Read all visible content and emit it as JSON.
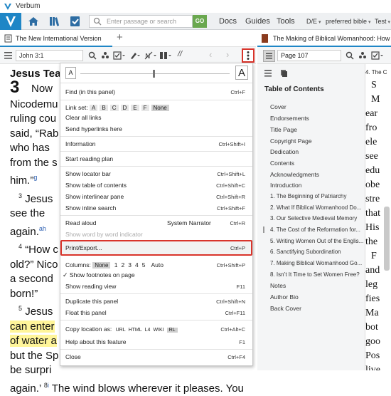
{
  "app": {
    "title": "Verbum"
  },
  "toolbar": {
    "search_placeholder": "Enter passage or search",
    "go_label": "GO",
    "docs_label": "Docs",
    "guides_label": "Guides",
    "tools_label": "Tools",
    "lang_label": "D/E",
    "bible_pref_label": "preferred bible",
    "test_label": "Test"
  },
  "left_panel": {
    "tab_title": "The New International Version",
    "reference": "John 3:1",
    "text": {
      "heading": "Jesus Tea",
      "chapter": "3",
      "lines": [
        "Now",
        "Nicodemu",
        "ruling cou",
        "said, “Rab",
        "who has",
        "from the s",
        "him.”",
        "Jesus",
        "see the",
        "again.",
        "“How c",
        "old?” Nico",
        "a second",
        "born!”",
        "Jesus",
        "can enter",
        "of water a",
        "but the Sp",
        "be surpri",
        "again.’"
      ],
      "verse_3": "3",
      "verse_4": "4",
      "verse_5": "5",
      "verse_8": "8",
      "fn_g": "g",
      "fn_ah": "a",
      "fn_h": "h",
      "fn_i": "i",
      "trailing_text": "The wind blows wherever it pleases. You"
    }
  },
  "dropdown": {
    "zoom_small": "A",
    "zoom_large": "A",
    "find_label": "Find (in this panel)",
    "find_key": "Ctrl+F",
    "link_set_label": "Link set:",
    "link_set_options": [
      "A",
      "B",
      "C",
      "D",
      "E",
      "F",
      "None"
    ],
    "clear_links": "Clear all links",
    "send_hyperlinks": "Send hyperlinks here",
    "information": "Information",
    "information_key": "Ctrl+Shift+I",
    "start_reading_plan": "Start reading plan",
    "show_locator_bar": "Show locator bar",
    "show_locator_bar_key": "Ctrl+Shift+L",
    "show_toc": "Show table of contents",
    "show_toc_key": "Ctrl+Shift+C",
    "show_interlinear": "Show interlinear pane",
    "show_interlinear_key": "Ctrl+Shift+R",
    "show_inline_search": "Show inline search",
    "show_inline_search_key": "Ctrl+Shift+F",
    "read_aloud": "Read aloud",
    "read_aloud_voice": "System Narrator",
    "read_aloud_key": "Ctrl+R",
    "show_word_indicator": "Show word by word indicator",
    "print_export": "Print/Export...",
    "print_export_key": "Ctrl+P",
    "columns_label": "Columns:",
    "columns_options": [
      "None",
      "1",
      "2",
      "3",
      "4",
      "5",
      "Auto"
    ],
    "columns_key": "Ctrl+Shift+P",
    "show_footnotes": "Show footnotes on page",
    "show_reading_view": "Show reading view",
    "show_reading_view_key": "F11",
    "duplicate_panel": "Duplicate this panel",
    "duplicate_panel_key": "Ctrl+Shift+N",
    "float_panel": "Float this panel",
    "float_panel_key": "Ctrl+F11",
    "copy_location_label": "Copy location as:",
    "copy_location_options": [
      "URL",
      "HTML",
      "L4",
      "WIKI",
      "RL"
    ],
    "copy_location_key": "Ctrl+Alt+C",
    "help_feature": "Help about this feature",
    "help_feature_key": "F1",
    "close": "Close",
    "close_key": "Ctrl+F4"
  },
  "right_panel": {
    "tab_title": "The Making of Biblical Womanhood: How the",
    "page": "Page 107",
    "subtab": "4. The C",
    "toc_title": "Table of Contents",
    "toc_items": [
      "Cover",
      "Endorsements",
      "Title Page",
      "Copyright Page",
      "Dedication",
      "Contents",
      "Acknowledgments",
      "Introduction",
      "1. The Beginning of Patriarchy",
      "2. What If Biblical Womanhood Do...",
      "3. Our Selective Medieval Memory",
      "4. The Cost of the Reformation for...",
      "5. Writing Women Out of the Englis...",
      "6. Sanctifying Subordination",
      "7. Making Biblical Womanhood Go...",
      "8. Isn’t It Time to Set Women Free?",
      "Notes",
      "Author Bio",
      "Back Cover"
    ],
    "content_lines": [
      "S",
      "M",
      "ear",
      "fro",
      "ele",
      "see",
      "edu",
      "obe",
      "stre",
      "that",
      "His",
      "the",
      "F",
      "and",
      "leg",
      "fies",
      "Ma",
      "bot",
      "goo",
      "Pos",
      "live"
    ]
  },
  "colors": {
    "accent": "#1f86c6",
    "highlight": "#fff59a",
    "callout": "#d9342b",
    "go_button": "#6aa84f"
  }
}
